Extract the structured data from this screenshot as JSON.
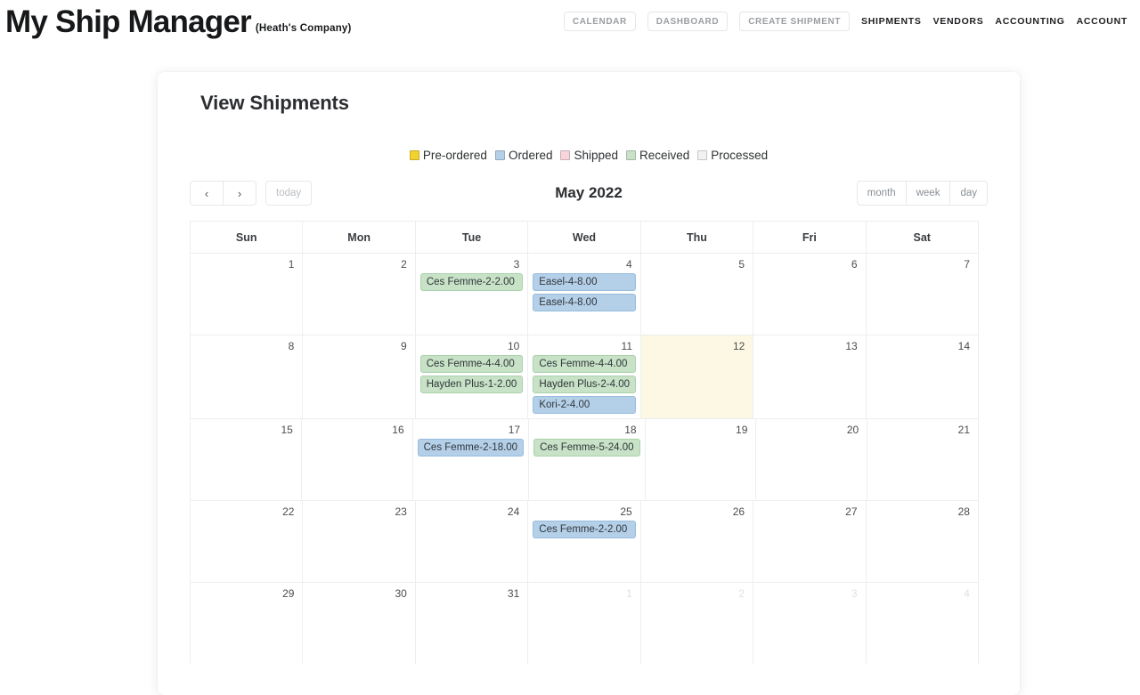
{
  "header": {
    "brand_title": "My Ship Manager",
    "brand_subtitle": "(Heath's Company)",
    "nav_buttons": [
      {
        "label": "CALENDAR"
      },
      {
        "label": "DASHBOARD"
      },
      {
        "label": "CREATE SHIPMENT"
      }
    ],
    "nav_links": [
      {
        "label": "SHIPMENTS"
      },
      {
        "label": "VENDORS"
      },
      {
        "label": "ACCOUNTING"
      },
      {
        "label": "ACCOUNT"
      }
    ]
  },
  "page": {
    "title": "View Shipments"
  },
  "legend": [
    {
      "label": "Pre-ordered",
      "color": "#f2d22e"
    },
    {
      "label": "Ordered",
      "color": "#b4cfe8"
    },
    {
      "label": "Shipped",
      "color": "#f7d5da"
    },
    {
      "label": "Received",
      "color": "#c7e2c7"
    },
    {
      "label": "Processed",
      "color": "#f2f2f2"
    }
  ],
  "calendar": {
    "prev_label": "‹",
    "next_label": "›",
    "today_label": "today",
    "title": "May 2022",
    "views": [
      {
        "label": "month"
      },
      {
        "label": "week"
      },
      {
        "label": "day"
      }
    ],
    "weekdays": [
      "Sun",
      "Mon",
      "Tue",
      "Wed",
      "Thu",
      "Fri",
      "Sat"
    ],
    "weeks": [
      [
        {
          "num": "1",
          "other": false,
          "today": false,
          "events": []
        },
        {
          "num": "2",
          "other": false,
          "today": false,
          "events": []
        },
        {
          "num": "3",
          "other": false,
          "today": false,
          "events": [
            {
              "label": "Ces Femme-2-2.00",
              "status": "received"
            }
          ]
        },
        {
          "num": "4",
          "other": false,
          "today": false,
          "events": [
            {
              "label": "Easel-4-8.00",
              "status": "ordered"
            },
            {
              "label": "Easel-4-8.00",
              "status": "ordered"
            }
          ]
        },
        {
          "num": "5",
          "other": false,
          "today": false,
          "events": []
        },
        {
          "num": "6",
          "other": false,
          "today": false,
          "events": []
        },
        {
          "num": "7",
          "other": false,
          "today": false,
          "events": []
        }
      ],
      [
        {
          "num": "8",
          "other": false,
          "today": false,
          "events": []
        },
        {
          "num": "9",
          "other": false,
          "today": false,
          "events": []
        },
        {
          "num": "10",
          "other": false,
          "today": false,
          "events": [
            {
              "label": "Ces Femme-4-4.00",
              "status": "received"
            },
            {
              "label": "Hayden Plus-1-2.00",
              "status": "received"
            }
          ]
        },
        {
          "num": "11",
          "other": false,
          "today": false,
          "events": [
            {
              "label": "Ces Femme-4-4.00",
              "status": "received"
            },
            {
              "label": "Hayden Plus-2-4.00",
              "status": "received"
            },
            {
              "label": "Kori-2-4.00",
              "status": "ordered"
            }
          ]
        },
        {
          "num": "12",
          "other": false,
          "today": true,
          "events": []
        },
        {
          "num": "13",
          "other": false,
          "today": false,
          "events": []
        },
        {
          "num": "14",
          "other": false,
          "today": false,
          "events": []
        }
      ],
      [
        {
          "num": "15",
          "other": false,
          "today": false,
          "events": []
        },
        {
          "num": "16",
          "other": false,
          "today": false,
          "events": []
        },
        {
          "num": "17",
          "other": false,
          "today": false,
          "events": [
            {
              "label": "Ces Femme-2-18.00",
              "status": "ordered"
            }
          ]
        },
        {
          "num": "18",
          "other": false,
          "today": false,
          "events": [
            {
              "label": "Ces Femme-5-24.00",
              "status": "received"
            }
          ]
        },
        {
          "num": "19",
          "other": false,
          "today": false,
          "events": []
        },
        {
          "num": "20",
          "other": false,
          "today": false,
          "events": []
        },
        {
          "num": "21",
          "other": false,
          "today": false,
          "events": []
        }
      ],
      [
        {
          "num": "22",
          "other": false,
          "today": false,
          "events": []
        },
        {
          "num": "23",
          "other": false,
          "today": false,
          "events": []
        },
        {
          "num": "24",
          "other": false,
          "today": false,
          "events": []
        },
        {
          "num": "25",
          "other": false,
          "today": false,
          "events": [
            {
              "label": "Ces Femme-2-2.00",
              "status": "ordered"
            }
          ]
        },
        {
          "num": "26",
          "other": false,
          "today": false,
          "events": []
        },
        {
          "num": "27",
          "other": false,
          "today": false,
          "events": []
        },
        {
          "num": "28",
          "other": false,
          "today": false,
          "events": []
        }
      ],
      [
        {
          "num": "29",
          "other": false,
          "today": false,
          "events": []
        },
        {
          "num": "30",
          "other": false,
          "today": false,
          "events": []
        },
        {
          "num": "31",
          "other": false,
          "today": false,
          "events": []
        },
        {
          "num": "1",
          "other": true,
          "today": false,
          "events": []
        },
        {
          "num": "2",
          "other": true,
          "today": false,
          "events": []
        },
        {
          "num": "3",
          "other": true,
          "today": false,
          "events": []
        },
        {
          "num": "4",
          "other": true,
          "today": false,
          "events": []
        }
      ]
    ]
  }
}
